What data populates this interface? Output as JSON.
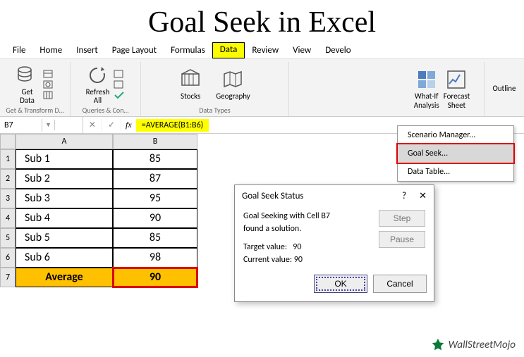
{
  "title": "Goal Seek in Excel",
  "menu": {
    "file": "File",
    "home": "Home",
    "insert": "Insert",
    "pagelayout": "Page Layout",
    "formulas": "Formulas",
    "data": "Data",
    "review": "Review",
    "view": "View",
    "develo": "Develo"
  },
  "ribbon": {
    "getdata": "Get\nData",
    "refresh": "Refresh\nAll",
    "stocks": "Stocks",
    "geography": "Geography",
    "whatif": "What-If\nAnalysis",
    "forecast": "Forecast\nSheet",
    "outline": "Outline",
    "g1": "Get & Transform D…",
    "g2": "Queries & Con…",
    "g3": "Data Types"
  },
  "fbar": {
    "namebox": "B7",
    "fx": "fx",
    "formula": "=AVERAGE(B1:B6)"
  },
  "cols": {
    "a": "A",
    "b": "B"
  },
  "rows": [
    {
      "n": "1",
      "a": "Sub 1",
      "b": "85"
    },
    {
      "n": "2",
      "a": "Sub 2",
      "b": "87"
    },
    {
      "n": "3",
      "a": "Sub 3",
      "b": "95"
    },
    {
      "n": "4",
      "a": "Sub 4",
      "b": "90"
    },
    {
      "n": "5",
      "a": "Sub 5",
      "b": "85"
    },
    {
      "n": "6",
      "a": "Sub 6",
      "b": "98"
    },
    {
      "n": "7",
      "a": "Average",
      "b": "90"
    }
  ],
  "dropdown": {
    "scenario": "Scenario Manager...",
    "goalseek": "Goal Seek...",
    "datatable": "Data Table..."
  },
  "dialog": {
    "title": "Goal Seek Status",
    "help": "?",
    "close": "✕",
    "line1": "Goal Seeking with Cell B7",
    "line2": "found a solution.",
    "target_lbl": "Target value:",
    "target_val": "90",
    "current_lbl": "Current value:",
    "current_val": "90",
    "step": "Step",
    "pause": "Pause",
    "ok": "OK",
    "cancel": "Cancel"
  },
  "watermark": "WallStreetMojo"
}
